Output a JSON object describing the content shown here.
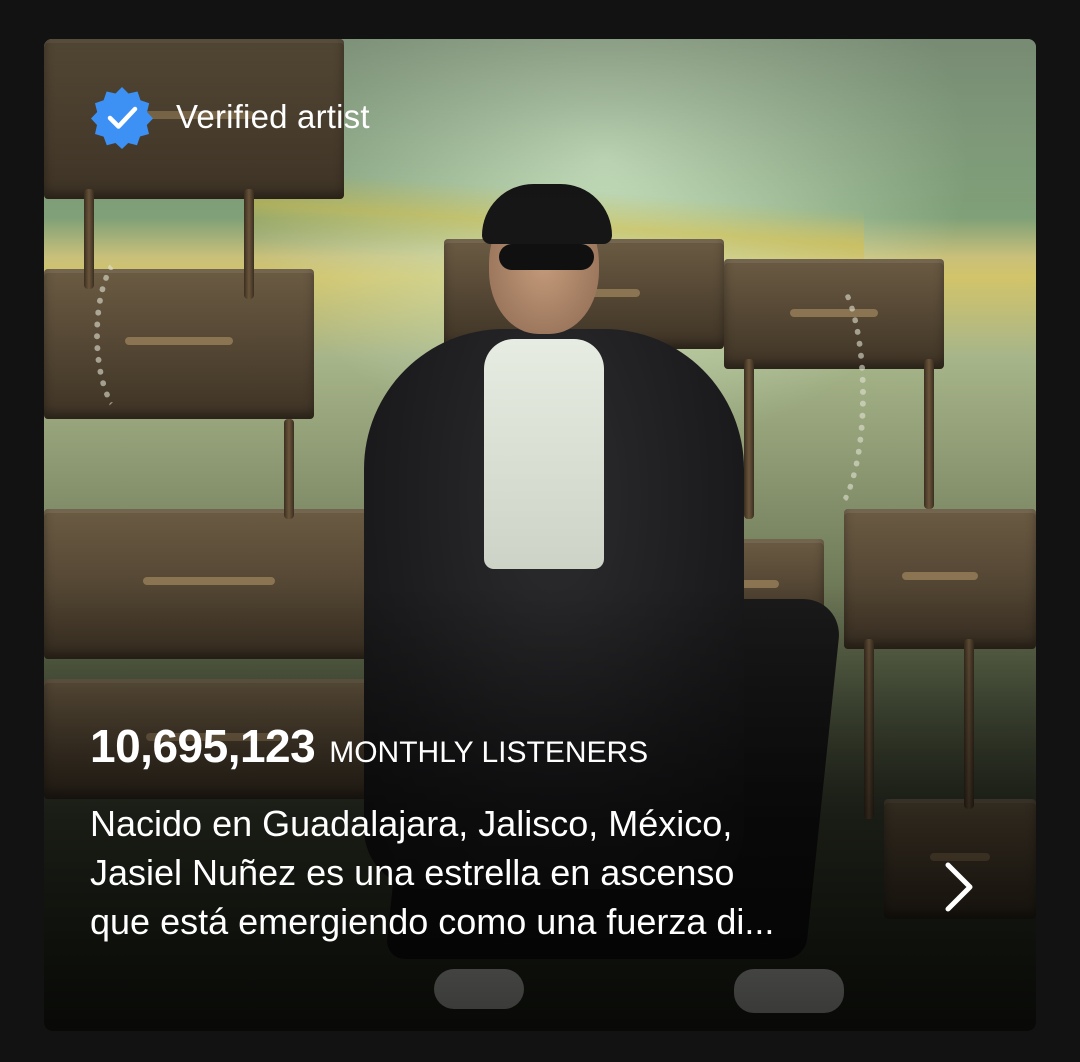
{
  "artist_card": {
    "verified_label": "Verified artist",
    "monthly_listeners": {
      "count": "10,695,123",
      "label": "MONTHLY LISTENERS"
    },
    "bio_lines": [
      "Nacido en Guadalajara, Jalisco, México,",
      "Jasiel Nuñez es una estrella en ascenso",
      "que está emergiendo como una fuerza di..."
    ]
  },
  "icons": {
    "verified": "verified-badge-icon",
    "expand": "chevron-right-icon"
  },
  "colors": {
    "background": "#121212",
    "verified_badge": "#4CB3FF",
    "text": "#FFFFFF"
  }
}
